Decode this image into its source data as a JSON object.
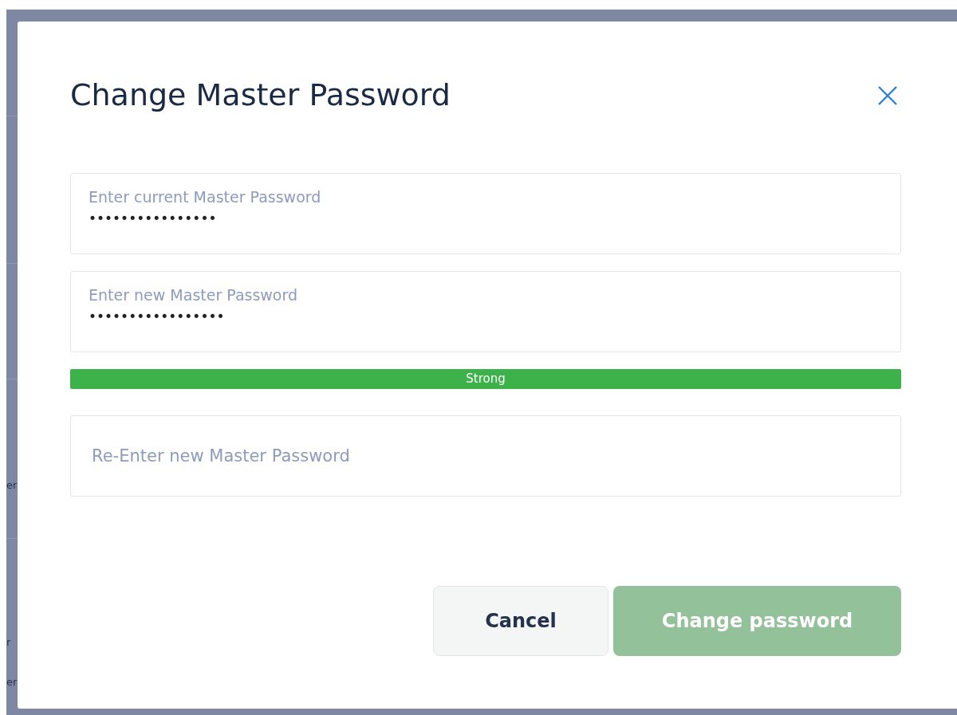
{
  "background": {
    "fragments": [
      "er",
      "r",
      "er"
    ]
  },
  "dialog": {
    "title": "Change Master Password",
    "fields": [
      {
        "label": "Enter current Master Password",
        "value": "••••••••••••••••"
      },
      {
        "label": "Enter new Master Password",
        "value": "•••••••••••••••••",
        "strength": {
          "label": "Strong",
          "level": 1
        }
      },
      {
        "placeholder": "Re-Enter new Master Password"
      }
    ],
    "buttons": [
      {
        "label": "Cancel",
        "kind": "secondary",
        "disabled": false
      },
      {
        "label": "Change password",
        "kind": "primary",
        "disabled": true
      }
    ]
  }
}
